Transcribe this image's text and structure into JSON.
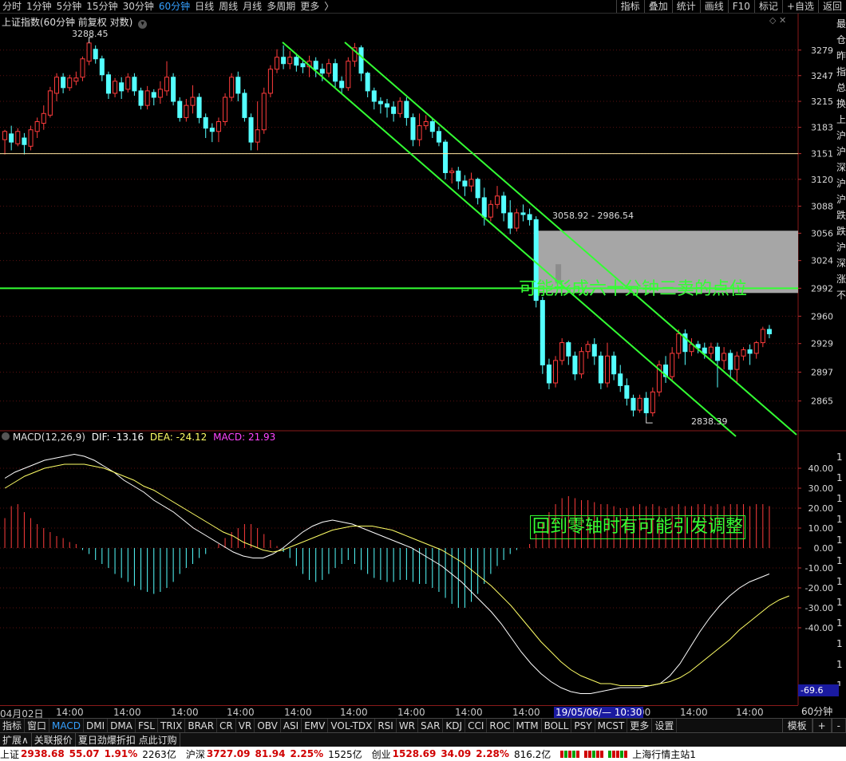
{
  "top_toolbar": {
    "periods": [
      "分时",
      "1分钟",
      "5分钟",
      "15分钟",
      "30分钟",
      "60分钟",
      "日线",
      "周线",
      "月线",
      "多周期",
      "更多"
    ],
    "active_period": "60分钟",
    "more_chevron": "〉",
    "right_buttons": [
      "指标",
      "叠加",
      "统计",
      "画线",
      "F10",
      "标记",
      "+自选",
      "返回"
    ]
  },
  "price_panel": {
    "title": "上证指数(60分钟 前复权 对数)",
    "high_label": "3288.45",
    "low_label": "2838.39",
    "range_label": "3058.92 - 2986.54",
    "annotation": "可能形成六十分钟三卖的点位",
    "y_ticks": [
      "3279",
      "3247",
      "3215",
      "3183",
      "3151",
      "3120",
      "3088",
      "3056",
      "3024",
      "2992",
      "2960",
      "2929",
      "2897",
      "2865"
    ],
    "side_strip": [
      "最",
      "仓",
      "昨",
      "指",
      "总",
      "换",
      "上",
      "沪",
      "沪",
      "深",
      "沪",
      "沪",
      "跌",
      "跌",
      "沪",
      "深",
      "涨",
      "不"
    ],
    "colors": {
      "up": "#ff3c3c",
      "down": "#54ffff",
      "channel": "#33ff33",
      "level": "#ffe6a0",
      "zone": "#a6a6a6"
    }
  },
  "macd_panel": {
    "title": "MACD(12,26,9)",
    "dif_label": "DIF: -13.16",
    "dea_label": "DEA: -24.12",
    "macd_label": "MACD: 21.93",
    "annotation": "回到零轴时有可能引发调整",
    "y_ticks": [
      "40.00",
      "30.00",
      "20.00",
      "10.00",
      "0.00",
      "-10.00",
      "-20.00",
      "-30.00",
      "-40.00"
    ],
    "cursor_value": "-69.6",
    "side_strip": [
      "1",
      "1",
      "1",
      "1",
      "1",
      "1",
      "1",
      "1",
      "1",
      "1",
      "1",
      "1"
    ],
    "colors": {
      "dif": "#ffffff",
      "dea": "#ffff66",
      "macd_label": "#ff44ff"
    }
  },
  "date_axis": {
    "labels": [
      "04月02日",
      "14:00",
      "14:00",
      "14:00",
      "14:00",
      "14:00",
      "14:00",
      "14:00",
      "14:00",
      "14:00",
      ":00",
      "14:00",
      "14:00"
    ],
    "cursor_label": "19/05/06/— 10:30",
    "period_box": "60分钟"
  },
  "indicator_tabs": {
    "tabs": [
      "指标",
      "窗口",
      "MACD",
      "DMI",
      "DMA",
      "FSL",
      "TRIX",
      "BRAR",
      "CR",
      "VR",
      "OBV",
      "ASI",
      "EMV",
      "VOL-TDX",
      "RSI",
      "WR",
      "SAR",
      "KDJ",
      "CCI",
      "ROC",
      "MTM",
      "BOLL",
      "PSY",
      "MCST",
      "更多",
      "设置"
    ],
    "active": "MACD",
    "right": [
      "模板",
      "+",
      "-"
    ]
  },
  "ext_bar": {
    "items": [
      "扩展∧",
      "关联报价",
      "夏日劲爆折扣 点此订购"
    ]
  },
  "status_bar": {
    "sh": {
      "name": "上证",
      "price": "2938.68",
      "change": "55.07",
      "pct": "1.91%",
      "amount": "2263亿"
    },
    "hs": {
      "name": "沪深",
      "price": "3727.09",
      "change": "81.94",
      "pct": "2.25%",
      "amount": "1525亿"
    },
    "cy": {
      "name": "创业",
      "price": "1528.69",
      "change": "34.09",
      "pct": "2.28%",
      "amount": "816.2亿"
    },
    "server": "上海行情主站1"
  },
  "chart_data": {
    "type": "candlestick",
    "price_axis": {
      "ylim": [
        2835,
        3300
      ],
      "scale": "log"
    },
    "candles": [
      [
        3168,
        3178,
        3150,
        3180
      ],
      [
        3175,
        3165,
        3155,
        3185
      ],
      [
        3163,
        3178,
        3160,
        3182
      ],
      [
        3170,
        3162,
        3150,
        3176
      ],
      [
        3160,
        3180,
        3155,
        3185
      ],
      [
        3178,
        3190,
        3170,
        3195
      ],
      [
        3188,
        3200,
        3180,
        3210
      ],
      [
        3198,
        3228,
        3195,
        3233
      ],
      [
        3225,
        3245,
        3215,
        3250
      ],
      [
        3245,
        3232,
        3225,
        3250
      ],
      [
        3232,
        3244,
        3228,
        3248
      ],
      [
        3240,
        3244,
        3235,
        3252
      ],
      [
        3245,
        3268,
        3240,
        3271
      ],
      [
        3265,
        3288,
        3260,
        3290
      ],
      [
        3280,
        3268,
        3262,
        3285
      ],
      [
        3268,
        3248,
        3240,
        3272
      ],
      [
        3248,
        3225,
        3218,
        3252
      ],
      [
        3225,
        3240,
        3220,
        3244
      ],
      [
        3238,
        3228,
        3218,
        3245
      ],
      [
        3230,
        3245,
        3226,
        3250
      ],
      [
        3245,
        3228,
        3222,
        3250
      ],
      [
        3228,
        3210,
        3205,
        3232
      ],
      [
        3210,
        3228,
        3205,
        3234
      ],
      [
        3226,
        3220,
        3210,
        3230
      ],
      [
        3220,
        3230,
        3212,
        3240
      ],
      [
        3228,
        3245,
        3222,
        3265
      ],
      [
        3245,
        3215,
        3210,
        3250
      ],
      [
        3215,
        3195,
        3190,
        3220
      ],
      [
        3195,
        3210,
        3190,
        3218
      ],
      [
        3210,
        3220,
        3200,
        3235
      ],
      [
        3220,
        3195,
        3188,
        3225
      ],
      [
        3195,
        3182,
        3170,
        3200
      ],
      [
        3182,
        3178,
        3165,
        3188
      ],
      [
        3178,
        3190,
        3165,
        3195
      ],
      [
        3190,
        3220,
        3185,
        3225
      ],
      [
        3220,
        3245,
        3215,
        3250
      ],
      [
        3245,
        3225,
        3215,
        3252
      ],
      [
        3225,
        3195,
        3190,
        3230
      ],
      [
        3195,
        3165,
        3155,
        3200
      ],
      [
        3165,
        3180,
        3155,
        3215
      ],
      [
        3180,
        3225,
        3175,
        3232
      ],
      [
        3225,
        3255,
        3220,
        3260
      ],
      [
        3255,
        3270,
        3250,
        3280
      ],
      [
        3270,
        3262,
        3255,
        3285
      ],
      [
        3262,
        3270,
        3255,
        3278
      ],
      [
        3270,
        3260,
        3252,
        3275
      ],
      [
        3262,
        3258,
        3250,
        3268
      ],
      [
        3258,
        3265,
        3245,
        3272
      ],
      [
        3265,
        3255,
        3245,
        3270
      ],
      [
        3255,
        3250,
        3240,
        3262
      ],
      [
        3250,
        3262,
        3245,
        3268
      ],
      [
        3262,
        3240,
        3232,
        3268
      ],
      [
        3240,
        3232,
        3225,
        3246
      ],
      [
        3232,
        3265,
        3228,
        3270
      ],
      [
        3265,
        3282,
        3258,
        3288
      ],
      [
        3282,
        3250,
        3240,
        3285
      ],
      [
        3250,
        3228,
        3220,
        3252
      ],
      [
        3228,
        3215,
        3205,
        3232
      ],
      [
        3215,
        3212,
        3200,
        3220
      ],
      [
        3212,
        3208,
        3195,
        3218
      ],
      [
        3208,
        3200,
        3190,
        3215
      ],
      [
        3200,
        3215,
        3195,
        3220
      ],
      [
        3215,
        3195,
        3185,
        3220
      ],
      [
        3195,
        3168,
        3160,
        3200
      ],
      [
        3168,
        3185,
        3160,
        3200
      ],
      [
        3185,
        3190,
        3180,
        3198
      ],
      [
        3190,
        3178,
        3170,
        3194
      ],
      [
        3178,
        3165,
        3160,
        3184
      ],
      [
        3165,
        3128,
        3120,
        3168
      ],
      [
        3128,
        3130,
        3115,
        3134
      ],
      [
        3130,
        3118,
        3108,
        3135
      ],
      [
        3118,
        3112,
        3100,
        3125
      ],
      [
        3112,
        3120,
        3105,
        3128
      ],
      [
        3120,
        3098,
        3090,
        3122
      ],
      [
        3098,
        3075,
        3065,
        3110
      ],
      [
        3075,
        3090,
        3070,
        3095
      ],
      [
        3090,
        3100,
        3085,
        3112
      ],
      [
        3100,
        3080,
        3070,
        3105
      ],
      [
        3080,
        3062,
        3055,
        3095
      ],
      [
        3062,
        3080,
        3058,
        3085
      ],
      [
        3080,
        3078,
        3070,
        3090
      ],
      [
        3078,
        3072,
        3065,
        3085
      ],
      [
        3072,
        2978,
        2970,
        3076
      ],
      [
        2978,
        2905,
        2895,
        2982
      ],
      [
        2905,
        2885,
        2878,
        2912
      ],
      [
        2885,
        2910,
        2880,
        2915
      ],
      [
        2910,
        2930,
        2905,
        2935
      ],
      [
        2930,
        2915,
        2905,
        2932
      ],
      [
        2915,
        2895,
        2888,
        2920
      ],
      [
        2895,
        2920,
        2890,
        2925
      ],
      [
        2920,
        2928,
        2912,
        2932
      ],
      [
        2928,
        2915,
        2905,
        2935
      ],
      [
        2915,
        2885,
        2878,
        2920
      ],
      [
        2885,
        2915,
        2880,
        2930
      ],
      [
        2915,
        2895,
        2888,
        2920
      ],
      [
        2895,
        2882,
        2875,
        2905
      ],
      [
        2882,
        2868,
        2860,
        2890
      ],
      [
        2868,
        2855,
        2848,
        2872
      ],
      [
        2855,
        2868,
        2852,
        2872
      ],
      [
        2868,
        2852,
        2848,
        2875
      ],
      [
        2852,
        2875,
        2848,
        2880
      ],
      [
        2875,
        2905,
        2870,
        2910
      ],
      [
        2905,
        2892,
        2885,
        2915
      ],
      [
        2892,
        2918,
        2888,
        2925
      ],
      [
        2918,
        2940,
        2912,
        2945
      ],
      [
        2940,
        2920,
        2905,
        2945
      ],
      [
        2920,
        2928,
        2915,
        2935
      ],
      [
        2928,
        2924,
        2918,
        2932
      ],
      [
        2924,
        2918,
        2912,
        2930
      ],
      [
        2918,
        2925,
        2912,
        2930
      ],
      [
        2925,
        2910,
        2880,
        2930
      ],
      [
        2910,
        2918,
        2900,
        2925
      ],
      [
        2918,
        2900,
        2890,
        2922
      ],
      [
        2900,
        2915,
        2885,
        2920
      ],
      [
        2915,
        2922,
        2910,
        2925
      ],
      [
        2922,
        2918,
        2905,
        2928
      ],
      [
        2918,
        2930,
        2912,
        2932
      ],
      [
        2930,
        2945,
        2925,
        2948
      ],
      [
        2945,
        2940,
        2935,
        2950
      ]
    ],
    "levels": [
      3151,
      2992
    ],
    "zone": [
      2986.54,
      3058.92
    ],
    "macd_axis": {
      "ylim": [
        -78,
        48
      ]
    },
    "macd_hist": [
      15,
      21,
      22,
      18,
      15,
      12,
      10,
      8,
      6,
      5,
      3,
      2,
      -1,
      -3,
      -6,
      -8,
      -10,
      -13,
      -15,
      -17,
      -19,
      -21,
      -22,
      -23,
      -22,
      -20,
      -17,
      -13,
      -10,
      -8,
      -5,
      -3,
      0,
      2,
      5,
      8,
      10,
      12,
      12,
      10,
      7,
      4,
      1,
      -2,
      -5,
      -9,
      -13,
      -16,
      -17,
      -16,
      -13,
      -10,
      -8,
      -6,
      -8,
      -11,
      -13,
      -15,
      -16,
      -17,
      -17,
      -16,
      -16,
      -17,
      -18,
      -18,
      -20,
      -22,
      -25,
      -28,
      -30,
      -30,
      -27,
      -23,
      -18,
      -13,
      -9,
      -6,
      -3,
      -1,
      0,
      2,
      7,
      13,
      18,
      22,
      25,
      26,
      25,
      24,
      24,
      23,
      22,
      22,
      21,
      20,
      20,
      21,
      22,
      21,
      22,
      21,
      20,
      21,
      22,
      21,
      21,
      22,
      22,
      21,
      22,
      21,
      22,
      22,
      22,
      21,
      22,
      22,
      21
    ],
    "dif": [
      35,
      38,
      40,
      42,
      44,
      45,
      46,
      47,
      46,
      44,
      41,
      38,
      34,
      31,
      28,
      24,
      21,
      18,
      14,
      10,
      7,
      4,
      1,
      -2,
      -4,
      -5,
      -5,
      -3,
      0,
      4,
      8,
      11,
      13,
      14,
      13,
      12,
      10,
      8,
      6,
      4,
      2,
      0,
      -3,
      -6,
      -9,
      -13,
      -17,
      -22,
      -27,
      -32,
      -38,
      -45,
      -52,
      -58,
      -63,
      -67,
      -70,
      -72,
      -73,
      -73,
      -72,
      -71,
      -70,
      -70,
      -70,
      -69,
      -68,
      -64,
      -58,
      -50,
      -42,
      -35,
      -29,
      -24,
      -20,
      -17,
      -15,
      -13
    ],
    "dea": [
      30,
      33,
      36,
      38,
      40,
      41,
      42,
      42,
      42,
      41,
      40,
      38,
      36,
      34,
      31,
      29,
      26,
      23,
      20,
      17,
      14,
      11,
      8,
      6,
      3,
      1,
      -1,
      -2,
      -1,
      1,
      3,
      5,
      7,
      9,
      10,
      11,
      11,
      11,
      10,
      9,
      7,
      5,
      3,
      1,
      -1,
      -4,
      -7,
      -11,
      -15,
      -19,
      -24,
      -29,
      -35,
      -41,
      -47,
      -52,
      -57,
      -61,
      -64,
      -66,
      -68,
      -68,
      -69,
      -69,
      -69,
      -69,
      -68,
      -67,
      -65,
      -62,
      -58,
      -54,
      -50,
      -46,
      -41,
      -37,
      -33,
      -29,
      -26,
      -24
    ]
  }
}
